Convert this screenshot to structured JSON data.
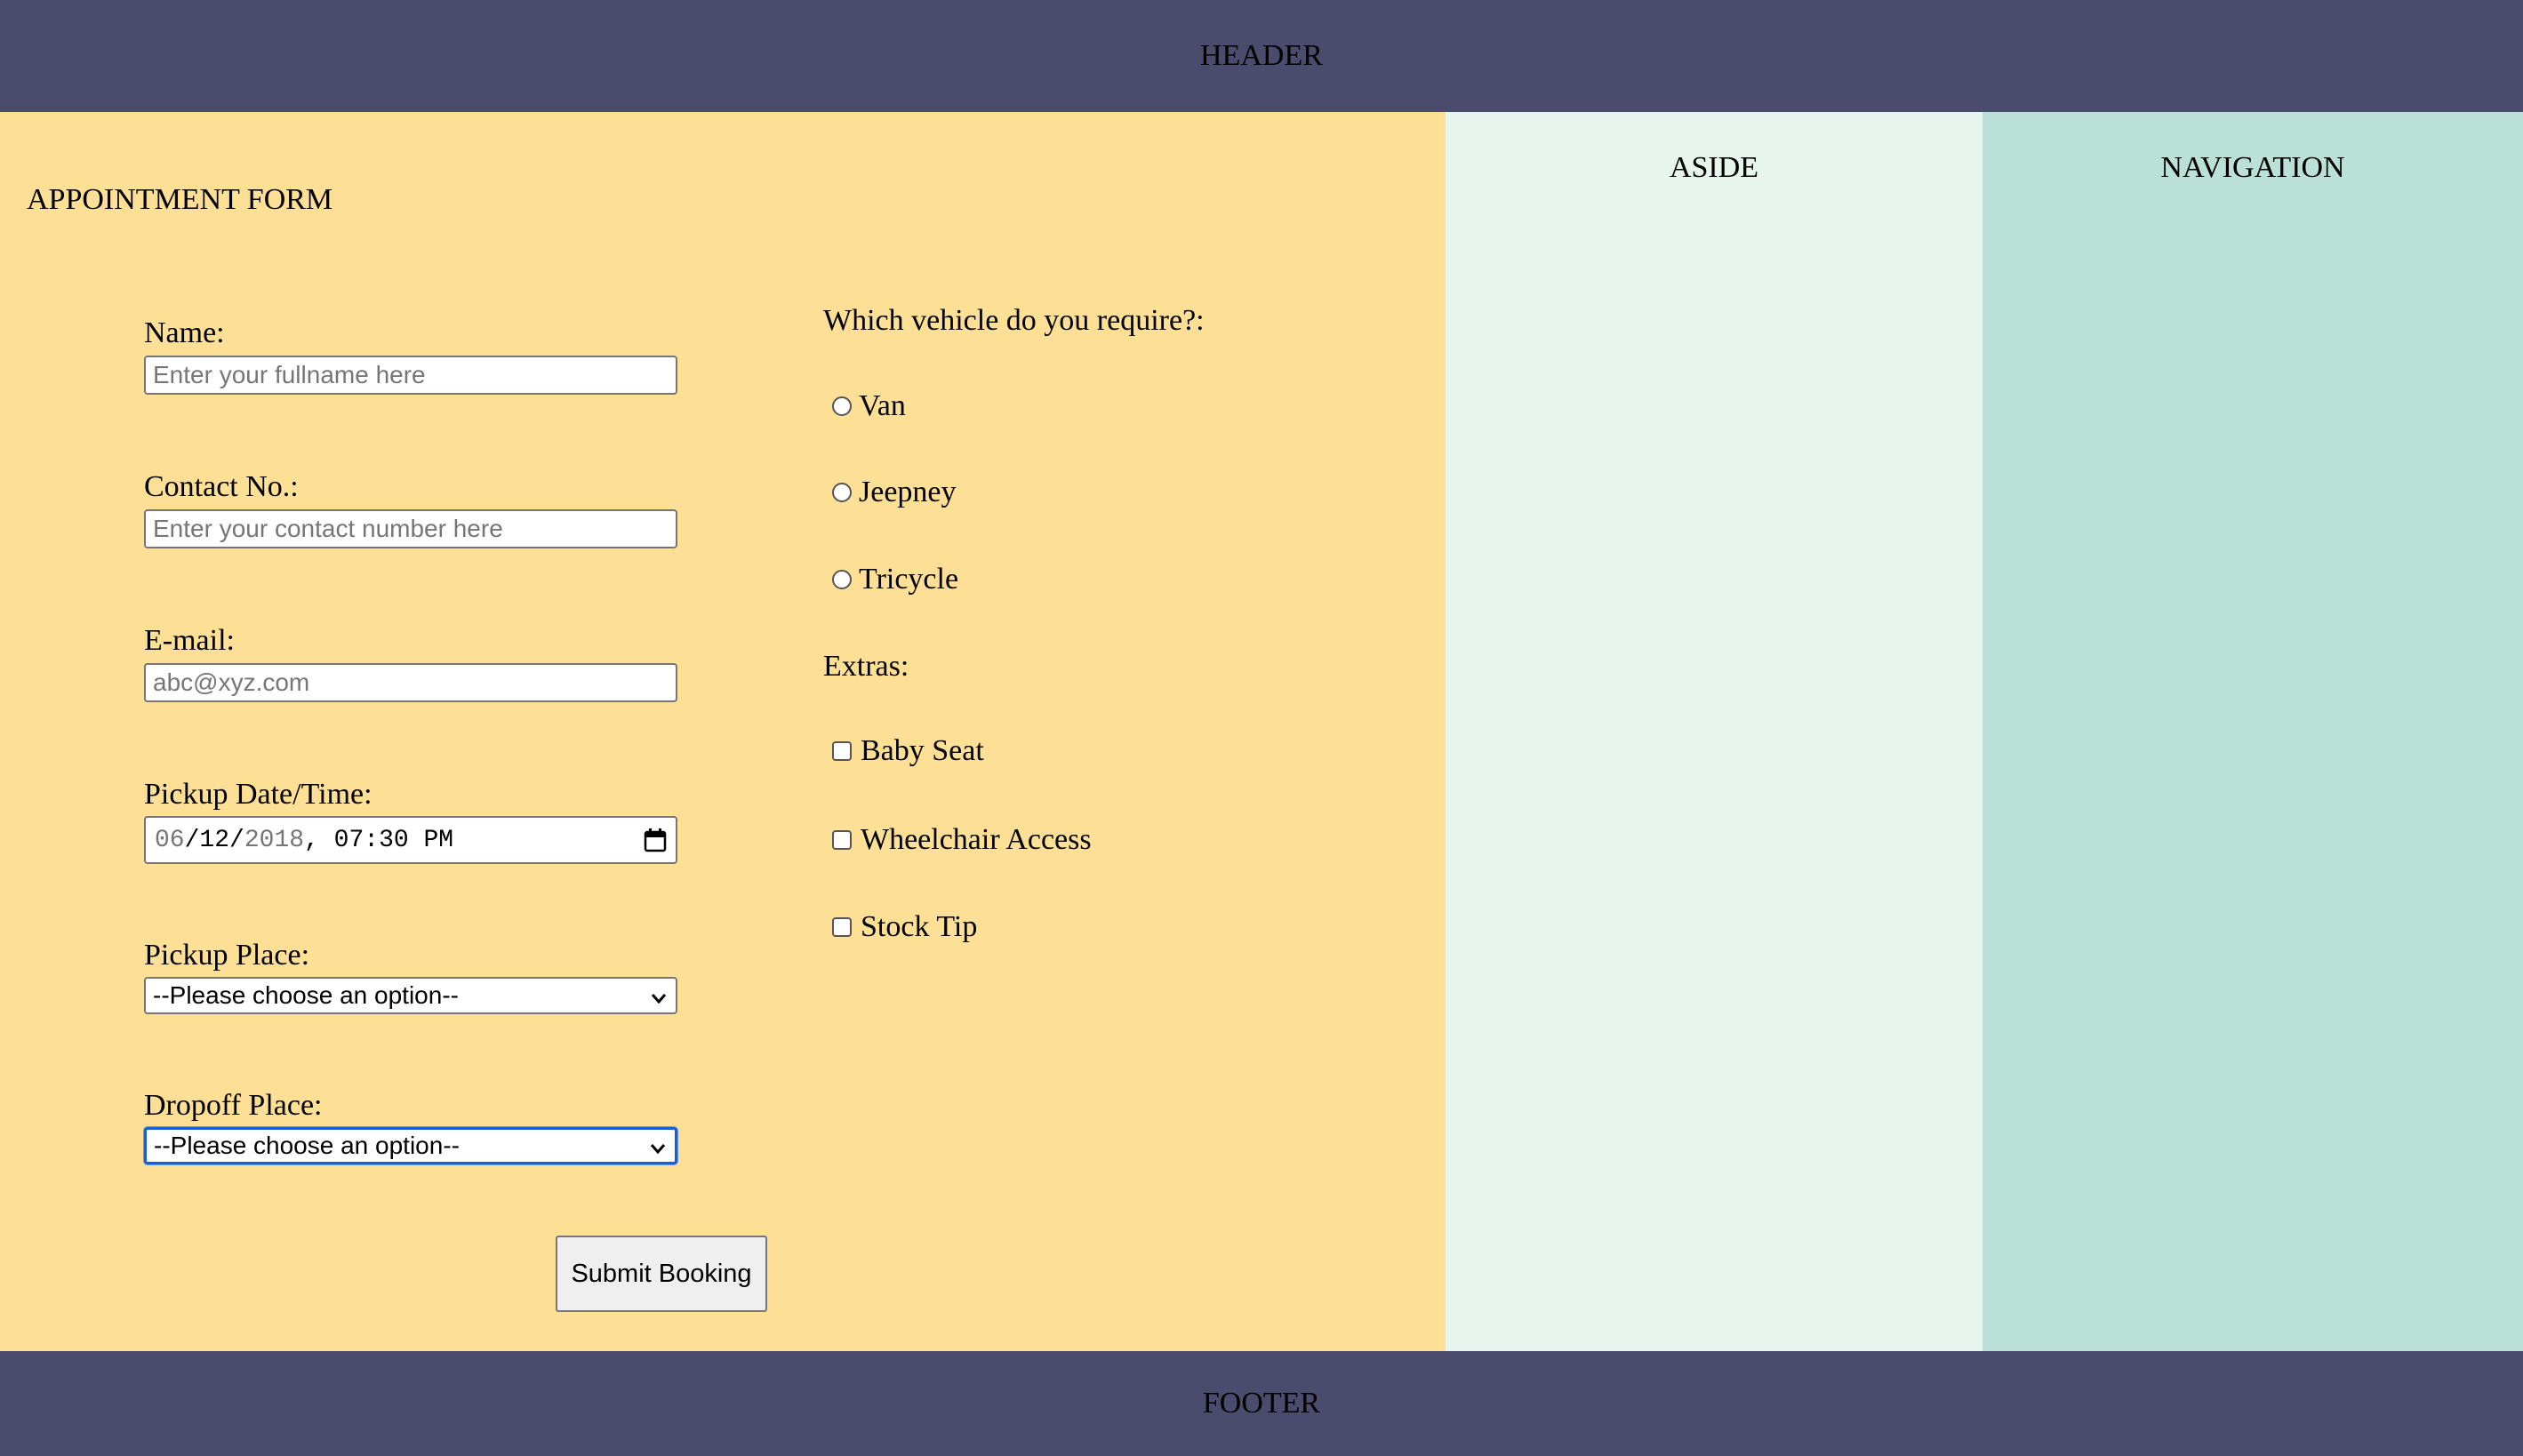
{
  "header": {
    "label": "HEADER"
  },
  "footer": {
    "label": "FOOTER"
  },
  "aside": {
    "label": "ASIDE"
  },
  "navigation": {
    "label": "NAVIGATION"
  },
  "colors": {
    "header_bg": "#4b4b6d",
    "main_bg": "#fde095",
    "aside_bg": "#e8f5ee",
    "nav_bg": "#bae0d8",
    "focus": "#1a5fd0"
  },
  "form": {
    "title": "APPOINTMENT FORM",
    "name": {
      "label": "Name:",
      "placeholder": "Enter your fullname here"
    },
    "contact": {
      "label": "Contact No.:",
      "placeholder": "Enter your contact number here"
    },
    "email": {
      "label": "E-mail:",
      "placeholder": "abc@xyz.com"
    },
    "pickup_datetime": {
      "label": "Pickup Date/Time:",
      "month": "06",
      "day": "12",
      "year": "2018",
      "time": "07:30 PM",
      "icon": "calendar-icon"
    },
    "pickup_place": {
      "label": "Pickup Place:",
      "selected": "--Please choose an option--"
    },
    "dropoff_place": {
      "label": "Dropoff Place:",
      "selected": "--Please choose an option--"
    },
    "vehicle": {
      "label": "Which vehicle do you require?:",
      "options": [
        {
          "label": "Van",
          "checked": false
        },
        {
          "label": "Jeepney",
          "checked": false
        },
        {
          "label": "Tricycle",
          "checked": false
        }
      ]
    },
    "extras": {
      "label": "Extras:",
      "options": [
        {
          "label": "Baby Seat",
          "checked": false
        },
        {
          "label": "Wheelchair Access",
          "checked": false
        },
        {
          "label": "Stock Tip",
          "checked": false
        }
      ]
    },
    "submit_label": "Submit Booking"
  }
}
